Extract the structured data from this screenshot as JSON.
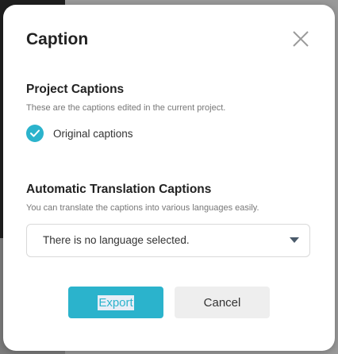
{
  "dialog": {
    "title": "Caption",
    "close_icon": "close-icon"
  },
  "project_captions": {
    "heading": "Project Captions",
    "description": "These are the captions edited in the current project.",
    "option_label": "Original captions",
    "option_checked": true
  },
  "auto_translation": {
    "heading": "Automatic Translation Captions",
    "description": "You can translate the captions into various languages easily.",
    "select_value": "There is no language selected.",
    "caret_icon": "caret-down-icon"
  },
  "buttons": {
    "export_label": "Export",
    "cancel_label": "Cancel"
  },
  "colors": {
    "accent": "#2bb3cc",
    "cancel_bg": "#eeeeee"
  }
}
